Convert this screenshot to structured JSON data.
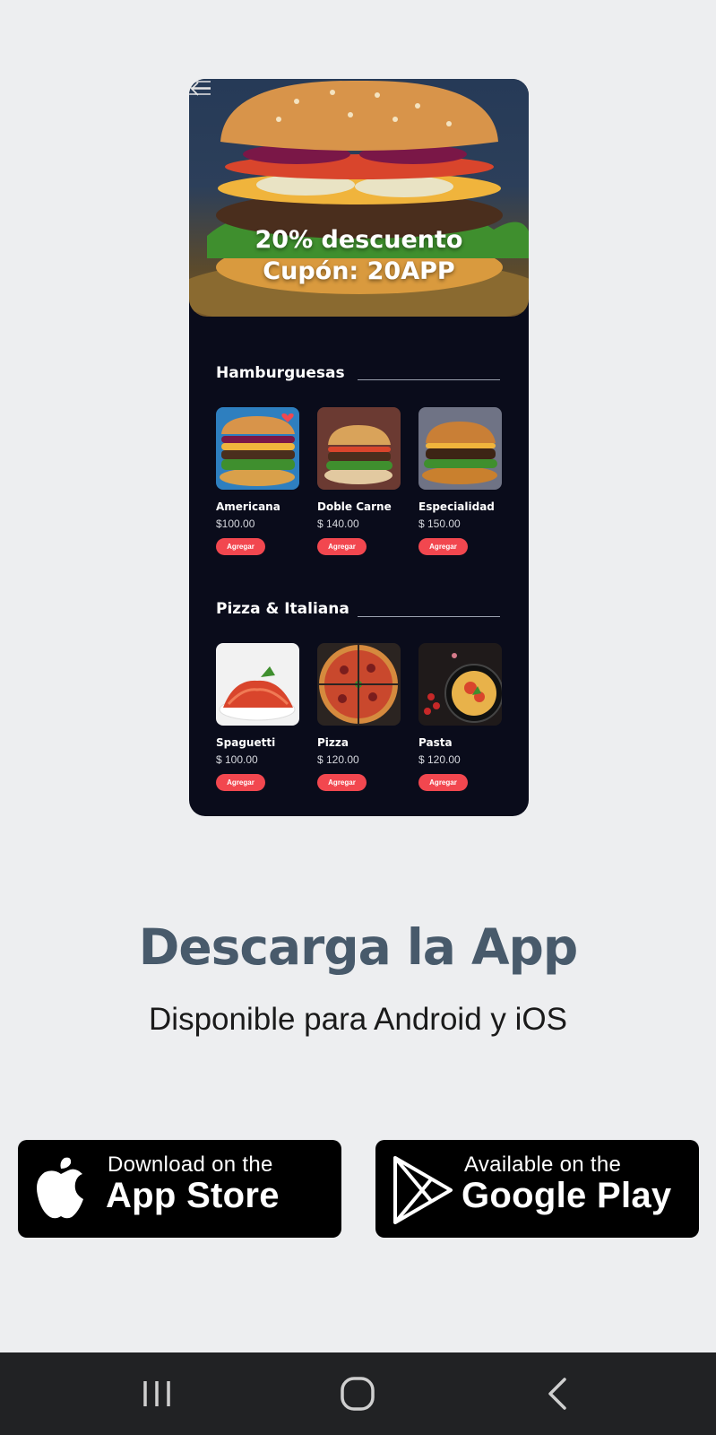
{
  "promo": {
    "line1": "20% descuento",
    "line2": "Cupón: 20APP"
  },
  "sections": [
    {
      "title": "Hamburguesas",
      "items": [
        {
          "name": "Americana",
          "price": "$100.00",
          "button": "Agregar"
        },
        {
          "name": "Doble Carne",
          "price": "$ 140.00",
          "button": "Agregar"
        },
        {
          "name": "Especialidad",
          "price": "$ 150.00",
          "button": "Agregar"
        }
      ]
    },
    {
      "title": "Pizza & Italiana",
      "items": [
        {
          "name": "Spaguetti",
          "price": "$ 100.00",
          "button": "Agregar"
        },
        {
          "name": "Pizza",
          "price": "$ 120.00",
          "button": "Agregar"
        },
        {
          "name": "Pasta",
          "price": "$ 120.00",
          "button": "Agregar"
        }
      ]
    }
  ],
  "download": {
    "title": "Descarga la App",
    "subtitle": "Disponible para Android y iOS"
  },
  "stores": {
    "apple": {
      "small": "Download on the",
      "big": "App Store"
    },
    "google": {
      "small": "Available on the",
      "big": "Google Play"
    }
  },
  "colors": {
    "accent": "#f2474f",
    "phone_bg": "#0a0c1b",
    "title": "#485a6b"
  },
  "icons": [
    "back-arrow-icon",
    "menu-icon",
    "heart-icon",
    "apple-icon",
    "google-play-icon",
    "recents-icon",
    "home-icon",
    "back-icon"
  ]
}
